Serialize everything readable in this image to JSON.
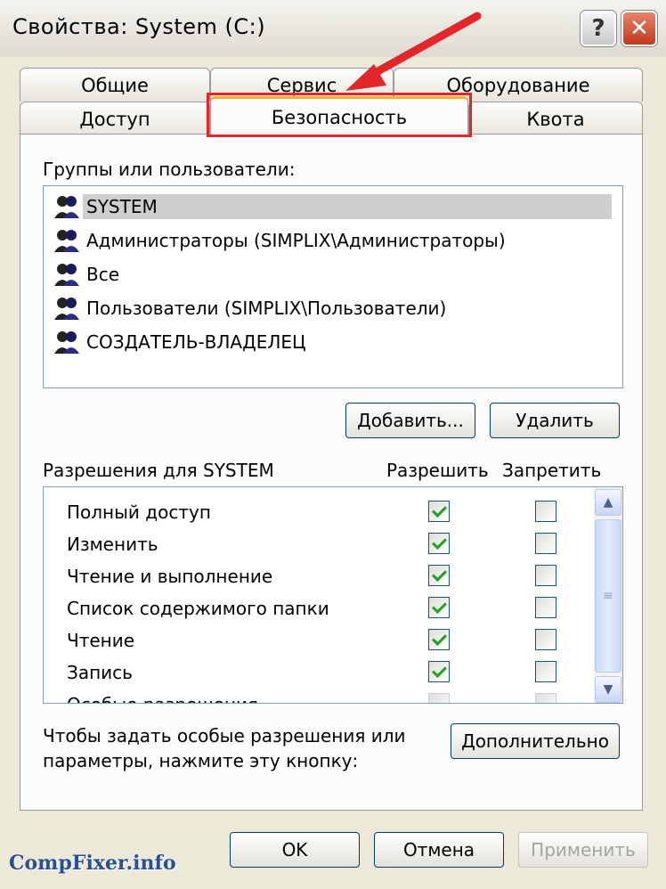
{
  "window": {
    "title": "Свойства: System (C:)"
  },
  "titlebar": {
    "help_glyph": "?",
    "close_glyph": "✕"
  },
  "tabs": {
    "row1": [
      "Общие",
      "Сервис",
      "Оборудование"
    ],
    "row2": [
      "Доступ",
      "Безопасность",
      "Квота"
    ],
    "active": "Безопасность"
  },
  "groups": {
    "label": "Группы или пользователи:",
    "items": [
      {
        "label": "SYSTEM",
        "icon": "user-group-icon",
        "selected": true
      },
      {
        "label": "Администраторы (SIMPLIX\\Администраторы)",
        "icon": "user-group-icon"
      },
      {
        "label": "Все",
        "icon": "user-group-icon"
      },
      {
        "label": "Пользователи (SIMPLIX\\Пользователи)",
        "icon": "user-group-icon"
      },
      {
        "label": "СОЗДАТЕЛЬ-ВЛАДЕЛЕЦ",
        "icon": "user-group-icon"
      }
    ],
    "add_button": "Добавить...",
    "remove_button": "Удалить"
  },
  "permissions": {
    "label": "Разрешения для SYSTEM",
    "allow_header": "Разрешить",
    "deny_header": "Запретить",
    "items": [
      {
        "name": "Полный доступ",
        "allow": true,
        "deny": false
      },
      {
        "name": "Изменить",
        "allow": true,
        "deny": false
      },
      {
        "name": "Чтение и выполнение",
        "allow": true,
        "deny": false
      },
      {
        "name": "Список содержимого папки",
        "allow": true,
        "deny": false
      },
      {
        "name": "Чтение",
        "allow": true,
        "deny": false
      },
      {
        "name": "Запись",
        "allow": true,
        "deny": false
      },
      {
        "name": "Особые разрешения",
        "allow": false,
        "deny": false
      }
    ]
  },
  "advanced": {
    "text_line1": "Чтобы задать особые разрешения или",
    "text_line2": "параметры, нажмите эту кнопку:",
    "button": "Дополнительно"
  },
  "footer": {
    "ok": "OK",
    "cancel": "Отмена",
    "apply": "Применить",
    "apply_disabled": true
  },
  "watermark": "CompFixer.info",
  "colors": {
    "highlight": "#e2262a",
    "checkmark": "#21a121",
    "watermark": "#2a4f9a"
  }
}
